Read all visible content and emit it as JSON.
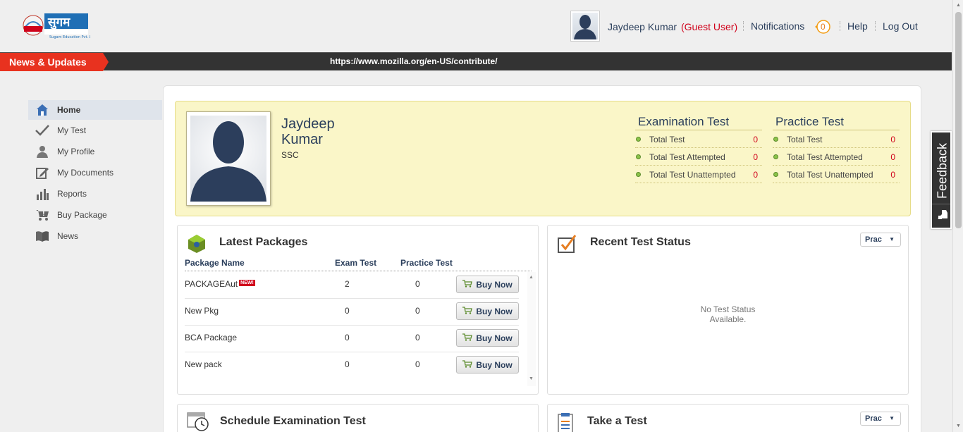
{
  "header": {
    "logo_text": "सुगम",
    "logo_subtext": "Sugam Education Pvt. Ltd.",
    "user_name": "Jaydeep Kumar",
    "guest_label": "(Guest User)",
    "notifications_label": "Notifications",
    "notifications_count": "0",
    "help_label": "Help",
    "logout_label": "Log Out"
  },
  "ticker": {
    "tab_label": "News & Updates",
    "text": "https://www.mozilla.org/en-US/contribute/"
  },
  "sidebar": {
    "items": [
      {
        "label": "Home",
        "icon": "home-icon"
      },
      {
        "label": "My Test",
        "icon": "check-icon"
      },
      {
        "label": "My Profile",
        "icon": "user-icon"
      },
      {
        "label": "My Documents",
        "icon": "edit-icon"
      },
      {
        "label": "Reports",
        "icon": "bar-chart-icon"
      },
      {
        "label": "Buy Package",
        "icon": "cart-icon"
      },
      {
        "label": "News",
        "icon": "book-icon"
      }
    ]
  },
  "profile": {
    "first_name": "Jaydeep",
    "last_name": "Kumar",
    "course": "SSC",
    "examination": {
      "title": "Examination Test",
      "rows": [
        {
          "label": "Total Test",
          "value": "0"
        },
        {
          "label": "Total Test Attempted",
          "value": "0"
        },
        {
          "label": "Total Test Unattempted",
          "value": "0"
        }
      ]
    },
    "practice": {
      "title": "Practice Test",
      "rows": [
        {
          "label": "Total Test",
          "value": "0"
        },
        {
          "label": "Total Test Attempted",
          "value": "0"
        },
        {
          "label": "Total Test Unattempted",
          "value": "0"
        }
      ]
    }
  },
  "packages": {
    "title": "Latest Packages",
    "columns": [
      "Package Name",
      "Exam Test",
      "Practice Test"
    ],
    "new_badge": "NEW!",
    "buy_label": "Buy Now",
    "rows": [
      {
        "name": "PACKAGEAut",
        "exam": "2",
        "practice": "0"
      },
      {
        "name": "New Pkg",
        "exam": "0",
        "practice": "0"
      },
      {
        "name": "BCA Package",
        "exam": "0",
        "practice": "0"
      },
      {
        "name": "New pack",
        "exam": "0",
        "practice": "0"
      }
    ]
  },
  "recent_status": {
    "title": "Recent Test Status",
    "filter_value": "Prac",
    "empty_line1": "No Test Status",
    "empty_line2": "Available."
  },
  "schedule": {
    "title": "Schedule Examination Test"
  },
  "take_test": {
    "title": "Take a Test",
    "filter_value": "Prac"
  },
  "feedback": {
    "label": "Feedback"
  },
  "colors": {
    "accent": "#2b3f5c",
    "red": "#d0021b",
    "ticker_bg": "#333333",
    "news_tab": "#e8321f",
    "profile_bg": "#faf6c8"
  }
}
